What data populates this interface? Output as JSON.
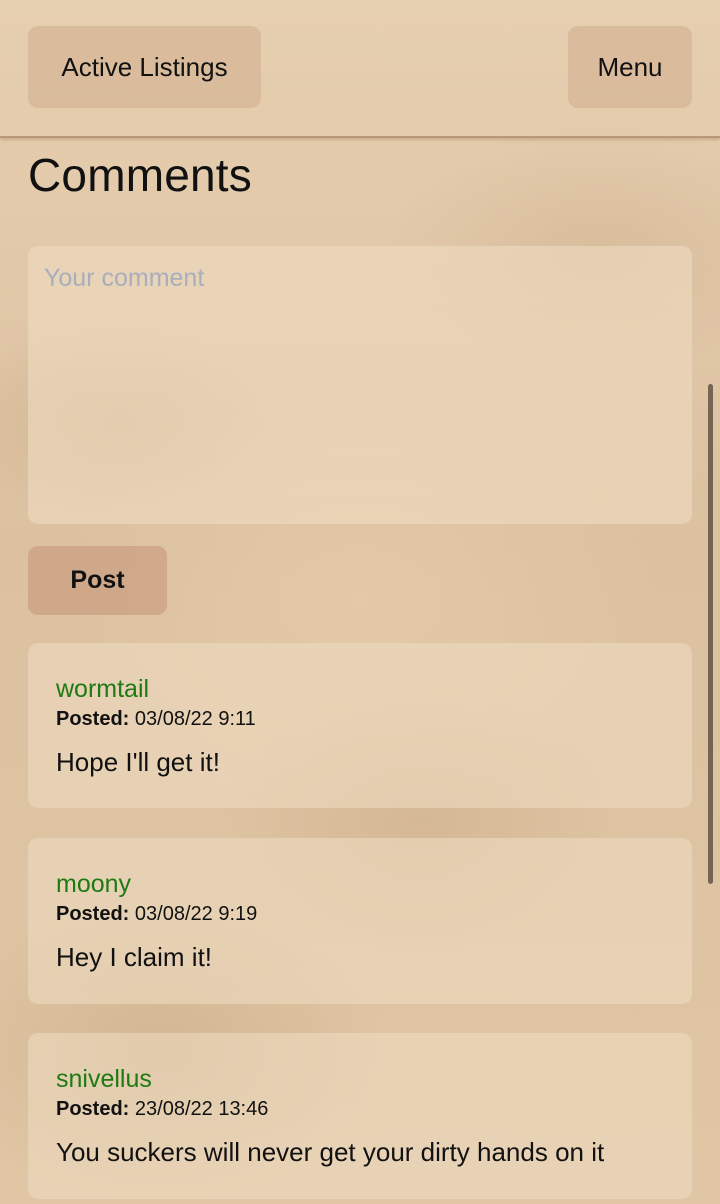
{
  "header": {
    "left_button": "Active Listings",
    "right_button": "Menu"
  },
  "page": {
    "title": "Comments"
  },
  "form": {
    "placeholder": "Your comment",
    "value": "",
    "post_label": "Post"
  },
  "comments": [
    {
      "author": "wormtail",
      "posted_label": "Posted:",
      "posted_at": "03/08/22 9:11",
      "text": "Hope I'll get it!"
    },
    {
      "author": "moony",
      "posted_label": "Posted:",
      "posted_at": "03/08/22 9:19",
      "text": "Hey I claim it!"
    },
    {
      "author": "snivellus",
      "posted_label": "Posted:",
      "posted_at": "23/08/22 13:46",
      "text": "You suckers will never get your dirty hands on it"
    }
  ],
  "colors": {
    "author": "#1e7a12",
    "parchment": "#e0c6a4",
    "button": "#c3947a",
    "placeholder": "#a8aebb"
  }
}
